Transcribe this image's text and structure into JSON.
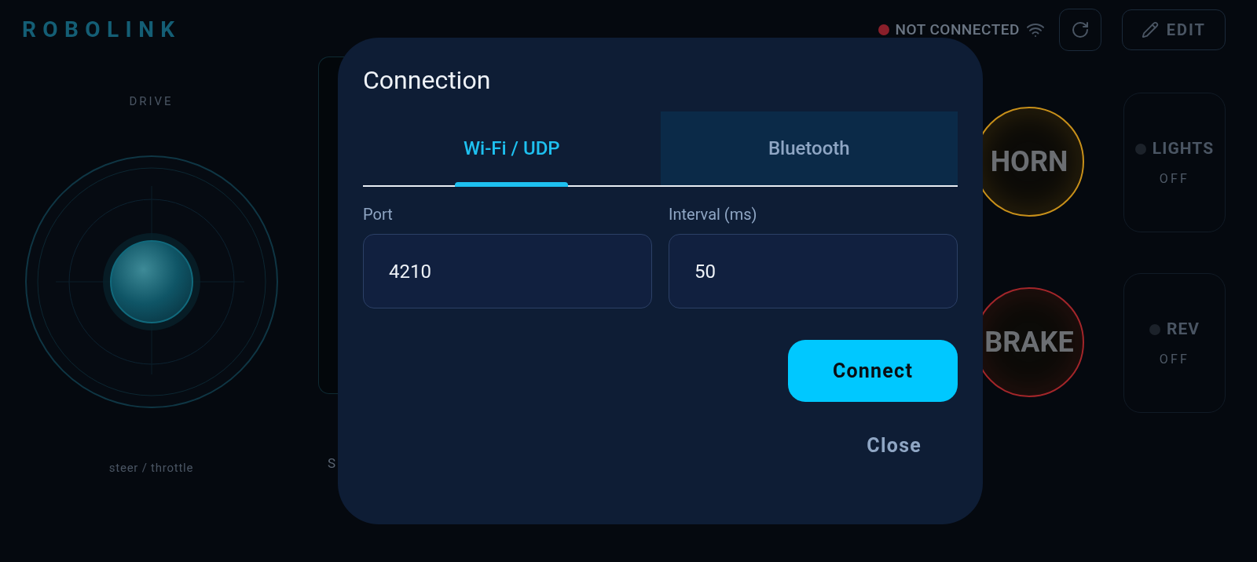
{
  "header": {
    "logo": "ROBOLINK",
    "status": {
      "label": "NOT CONNECTED",
      "connected": false
    },
    "edit_button": "EDIT"
  },
  "joystick": {
    "title": "DRIVE",
    "caption": "steer / throttle"
  },
  "slider_panel": {
    "caption": "S"
  },
  "buttons": [
    {
      "label": "HORN",
      "color": "#c8901a"
    },
    {
      "label": "BRAKE",
      "color": "#a3262a"
    }
  ],
  "toggles": [
    {
      "label": "LIGHTS",
      "state": "OFF",
      "on": false
    },
    {
      "label": "REV",
      "state": "OFF",
      "on": false
    }
  ],
  "dialog": {
    "title": "Connection",
    "tabs": [
      {
        "label": "Wi-Fi / UDP",
        "selected": true
      },
      {
        "label": "Bluetooth",
        "selected": false
      }
    ],
    "fields": [
      {
        "label": "Port",
        "value": "4210"
      },
      {
        "label": "Interval (ms)",
        "value": "50"
      }
    ],
    "primary_button": "Connect",
    "close_button": "Close"
  }
}
